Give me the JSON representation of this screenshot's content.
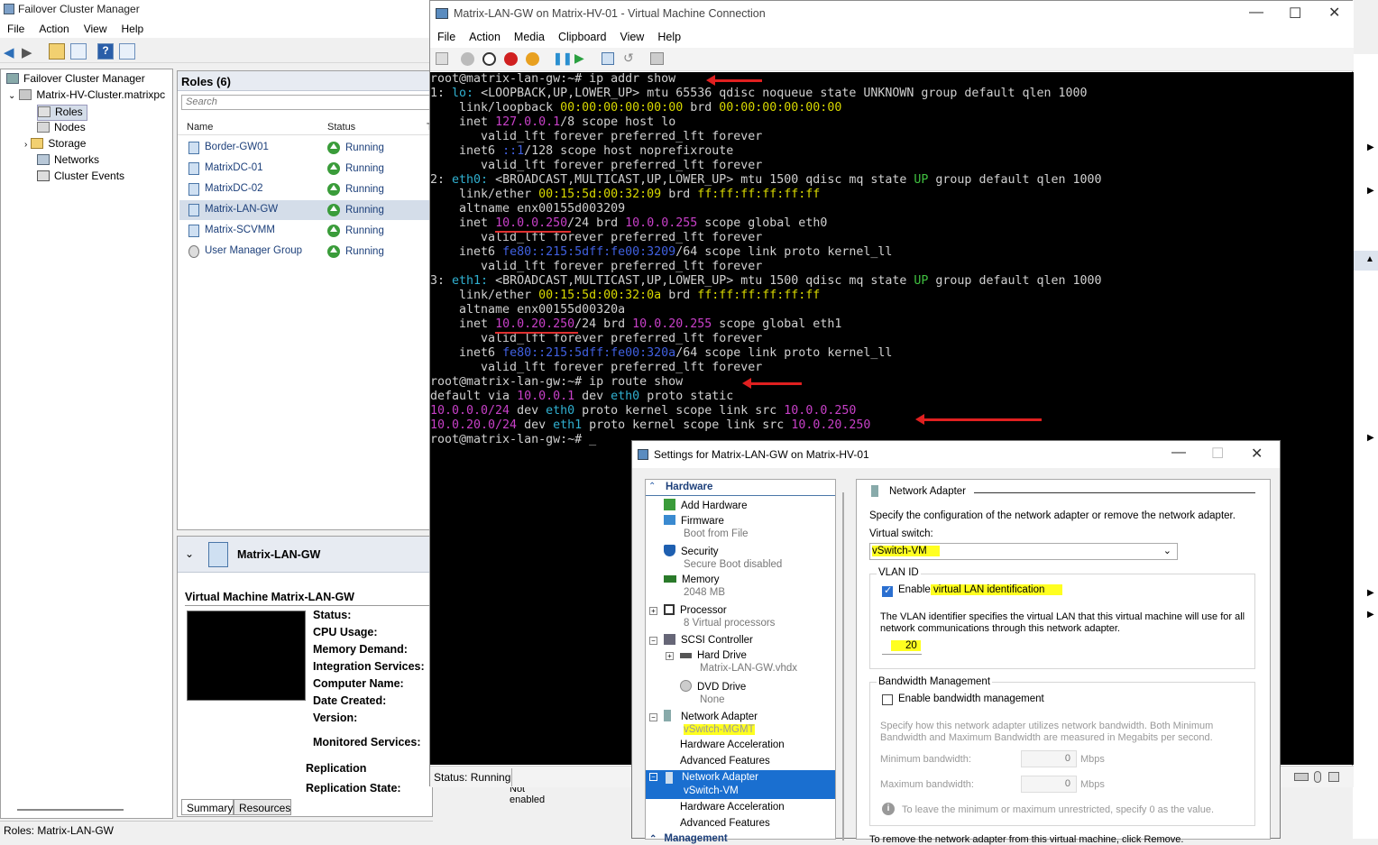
{
  "fcm": {
    "title": "Failover Cluster Manager",
    "menu": [
      "File",
      "Action",
      "View",
      "Help"
    ],
    "tree": {
      "root": "Failover Cluster Manager",
      "cluster": "Matrix-HV-Cluster.matrixpc",
      "items": [
        "Roles",
        "Nodes",
        "Storage",
        "Networks",
        "Cluster Events"
      ]
    },
    "roles": {
      "header": "Roles (6)",
      "search_placeholder": "Search",
      "col_name": "Name",
      "col_status": "Status",
      "col_type": "T",
      "rows": [
        {
          "name": "Border-GW01",
          "status": "Running"
        },
        {
          "name": "MatrixDC-01",
          "status": "Running"
        },
        {
          "name": "MatrixDC-02",
          "status": "Running"
        },
        {
          "name": "Matrix-LAN-GW",
          "status": "Running"
        },
        {
          "name": "Matrix-SCVMM",
          "status": "Running"
        },
        {
          "name": "User Manager Group",
          "status": "Running"
        }
      ]
    },
    "detail": {
      "title": "Matrix-LAN-GW",
      "section": "Virtual Machine Matrix-LAN-GW",
      "fields": [
        "Status:",
        "CPU Usage:",
        "Memory Demand:",
        "Integration Services:",
        "Computer Name:",
        "Date Created:",
        "Version:",
        "Monitored Services:"
      ],
      "replication": "Replication",
      "replication_state": "Replication State:",
      "replication_value": "Not enabled",
      "tabs": [
        "Summary",
        "Resources"
      ]
    },
    "status_bar": "Roles:  Matrix-LAN-GW"
  },
  "vmc": {
    "title": "Matrix-LAN-GW on Matrix-HV-01 - Virtual Machine Connection",
    "menu": [
      "File",
      "Action",
      "Media",
      "Clipboard",
      "View",
      "Help"
    ],
    "status": "Status: Running",
    "terminal": [
      "root@matrix-lan-gw:~# ip addr show",
      "1: lo: <LOOPBACK,UP,LOWER_UP> mtu 65536 qdisc noqueue state UNKNOWN group default qlen 1000",
      "    link/loopback 00:00:00:00:00:00 brd 00:00:00:00:00:00",
      "    inet 127.0.0.1/8 scope host lo",
      "       valid_lft forever preferred_lft forever",
      "    inet6 ::1/128 scope host noprefixroute",
      "       valid_lft forever preferred_lft forever",
      "2: eth0: <BROADCAST,MULTICAST,UP,LOWER_UP> mtu 1500 qdisc mq state UP group default qlen 1000",
      "    link/ether 00:15:5d:00:32:09 brd ff:ff:ff:ff:ff:ff",
      "    altname enx00155d003209",
      "    inet 10.0.0.250/24 brd 10.0.0.255 scope global eth0",
      "       valid_lft forever preferred_lft forever",
      "    inet6 fe80::215:5dff:fe00:3209/64 scope link proto kernel_ll",
      "       valid_lft forever preferred_lft forever",
      "3: eth1: <BROADCAST,MULTICAST,UP,LOWER_UP> mtu 1500 qdisc mq state UP group default qlen 1000",
      "    link/ether 00:15:5d:00:32:0a brd ff:ff:ff:ff:ff:ff",
      "    altname enx00155d00320a",
      "    inet 10.0.20.250/24 brd 10.0.20.255 scope global eth1",
      "       valid_lft forever preferred_lft forever",
      "    inet6 fe80::215:5dff:fe00:320a/64 scope link proto kernel_ll",
      "       valid_lft forever preferred_lft forever",
      "root@matrix-lan-gw:~# ip route show",
      "default via 10.0.0.1 dev eth0 proto static",
      "10.0.0.0/24 dev eth0 proto kernel scope link src 10.0.0.250",
      "10.0.20.0/24 dev eth1 proto kernel scope link src 10.0.20.250",
      "root@matrix-lan-gw:~# _"
    ]
  },
  "dialog": {
    "title": "Settings for Matrix-LAN-GW on Matrix-HV-01",
    "hardware_header": "Hardware",
    "hardware": [
      {
        "label": "Add Hardware",
        "sub": ""
      },
      {
        "label": "Firmware",
        "sub": "Boot from File"
      },
      {
        "label": "Security",
        "sub": "Secure Boot disabled"
      },
      {
        "label": "Memory",
        "sub": "2048 MB"
      },
      {
        "label": "Processor",
        "sub": "8 Virtual processors"
      },
      {
        "label": "SCSI Controller",
        "sub": ""
      },
      {
        "label": "Hard Drive",
        "sub": "Matrix-LAN-GW.vhdx"
      },
      {
        "label": "DVD Drive",
        "sub": "None"
      },
      {
        "label": "Network Adapter",
        "sub": "vSwitch-MGMT"
      },
      {
        "label": "Hardware Acceleration",
        "sub": ""
      },
      {
        "label": "Advanced Features",
        "sub": ""
      },
      {
        "label": "Network Adapter",
        "sub": "vSwitch-VM"
      },
      {
        "label": "Hardware Acceleration",
        "sub": ""
      },
      {
        "label": "Advanced Features",
        "sub": ""
      }
    ],
    "management_header": "Management",
    "panel": {
      "heading": "Network Adapter",
      "desc": "Specify the configuration of the network adapter or remove the network adapter.",
      "vswitch_label": "Virtual switch:",
      "vswitch_value": "vSwitch-VM",
      "vlan_group": "VLAN ID",
      "vlan_check_prefix": "Enable",
      "vlan_check_rest": " virtual LAN identification",
      "vlan_desc_1": "The VLAN identifier specifies the virtual LAN that this virtual machine will use for all",
      "vlan_desc_2": "network communications through this network adapter.",
      "vlan_id": "20",
      "bw_group": "Bandwidth Management",
      "bw_check": "Enable bandwidth management",
      "bw_desc_1": "Specify how this network adapter utilizes network bandwidth. Both Minimum",
      "bw_desc_2": "Bandwidth and Maximum Bandwidth are measured in Megabits per second.",
      "min_label": "Minimum bandwidth:",
      "min_value": "0",
      "max_label": "Maximum bandwidth:",
      "max_value": "0",
      "unit": "Mbps",
      "info": "To leave the minimum or maximum unrestricted, specify 0 as the value.",
      "remove_text": "To remove the network adapter from this virtual machine, click Remove."
    }
  }
}
